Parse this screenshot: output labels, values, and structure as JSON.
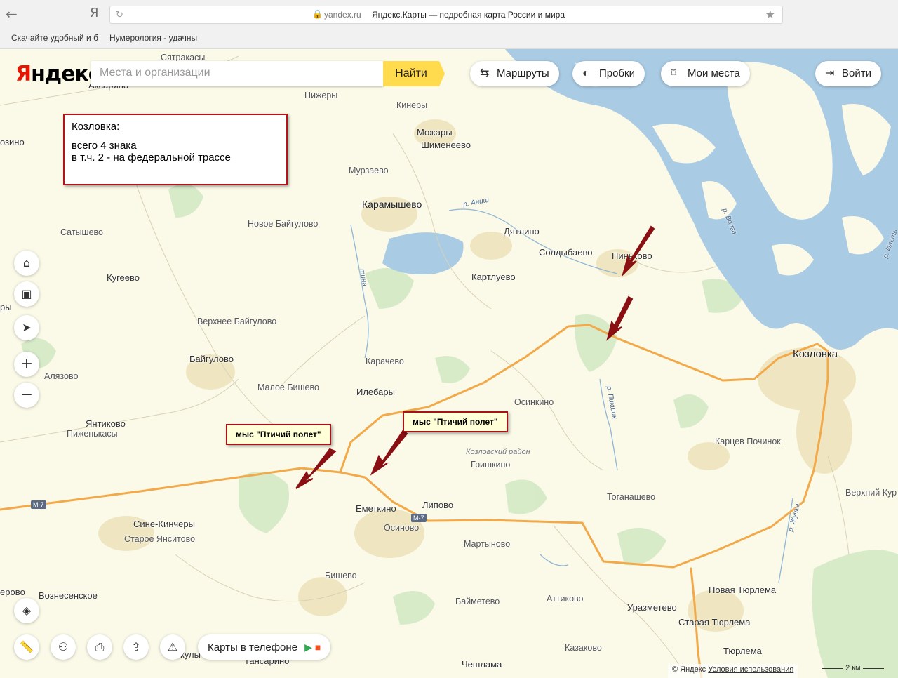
{
  "browser": {
    "back_icon": "arrow-left",
    "brand_letter": "Я",
    "domain": "yandex.ru",
    "page_title": "Яндекс.Карты — подробная карта России и мира",
    "bookmarks": [
      "Скачайте удобный и б",
      "Нумерология - удачны"
    ]
  },
  "header": {
    "logo_first": "Я",
    "logo_rest": "ндекс",
    "search_placeholder": "Места и организации",
    "find_label": "Найти",
    "routes_label": "Маршруты",
    "traffic_label": "Пробки",
    "places_label": "Мои места",
    "login_label": "Войти"
  },
  "callout": {
    "title": "Козловка:",
    "line1": "всего 4 знака",
    "line2": "в т.ч. 2 - на федеральной трассе"
  },
  "tags": {
    "left": "мыс \"Птичий полет\"",
    "right": "мыс \"Птичий полет\""
  },
  "places": {
    "Kozlovka": "Козловка",
    "Karamyshevo": "Карамышево",
    "Dyatlino": "Дятлино",
    "Soldybaevo": "Солдыбаево",
    "Pinyakovo": "Пиньково",
    "Kartluevo": "Картлуево",
    "Mozhary": "Можары",
    "Shimeneevo": "Шименеево",
    "Kinery": "Кинеры",
    "Nizhery": "Нижеры",
    "Murzaevo": "Мурзаево",
    "Novoe Baygulovo": "Новое Байгулово",
    "Satyshevo": "Сатышево",
    "Kugeevo": "Кугеево",
    "Verhnee Baygulovo": "Верхнее Байгулово",
    "Baygulovo": "Байгулово",
    "Karachevo": "Карачево",
    "Ilebary": "Илебары",
    "Maloe Bishevo": "Малое Бишево",
    "Osinkino": "Осинкино",
    "Yantikovo": "Янтиково",
    "Pizhenkasy": "Пиженькасы",
    "Emetkino": "Еметкино",
    "Lipovo": "Липово",
    "Osinovo": "Осиново",
    "Grishkino": "Гришкино",
    "Martynovo": "Мартыново",
    "Togana": "Тоганашево",
    "Kartsev": "Карцев Починок",
    "Verkhny": "Верхний Кур",
    "Sine": "Сине-Кинчеры",
    "Staroe": "Старое Янситово",
    "Voznesenskoe": "Вознесенское",
    "Bishevo": "Бишево",
    "Baymetevo": "Байметево",
    "Attikovo": "Аттиково",
    "Urazmetevo": "Уразметево",
    "NovTyurlema": "Новая Тюрлема",
    "StarTyurlema": "Старая Тюрлема",
    "Tyurlema": "Тюрлема",
    "Kazakovo": "Казаково",
    "Cheshlama": "Чешлама",
    "Tansarino": "Тансарино",
    "Syatrakasy": "Сятракасы",
    "Aksarino": "Аксарино",
    "Azino": "озино",
    "Ry": "ры",
    "Alyazovo": "Алязово",
    "Erovo": "еровo",
    "Kuly": "кулы"
  },
  "rivers": {
    "Volga": "р. Волга",
    "Anish": "р. Аниш",
    "Anish2": "тина",
    "Pikshik": "р. Пикшик",
    "Ilet": "р. Илеть",
    "Zhuchka": "р. Жучка"
  },
  "region_label": "Козловский район",
  "road_shields": [
    "М-7",
    "М-7"
  ],
  "controls": {
    "home_icon": "home-icon",
    "briefcase_icon": "briefcase-icon",
    "locate_icon": "locate-icon",
    "zoom_in": "+",
    "zoom_out": "−",
    "layers_icon": "layers-icon",
    "ruler_icon": "ruler-icon",
    "panorama_icon": "binoculars-icon",
    "print_icon": "print-icon",
    "share_icon": "share-icon",
    "warning_icon": "warning-icon"
  },
  "app_promo": "Карты в телефоне",
  "copyright": "© Яндекс",
  "terms": "Условия использования",
  "scale": "2 км",
  "colors": {
    "map_bg": "#fbf9e7",
    "water": "#a9cbe4",
    "forest": "#d3e9c5",
    "road_major": "#f2a94a",
    "annotation": "#a81318",
    "accent": "#ffdb4d"
  }
}
